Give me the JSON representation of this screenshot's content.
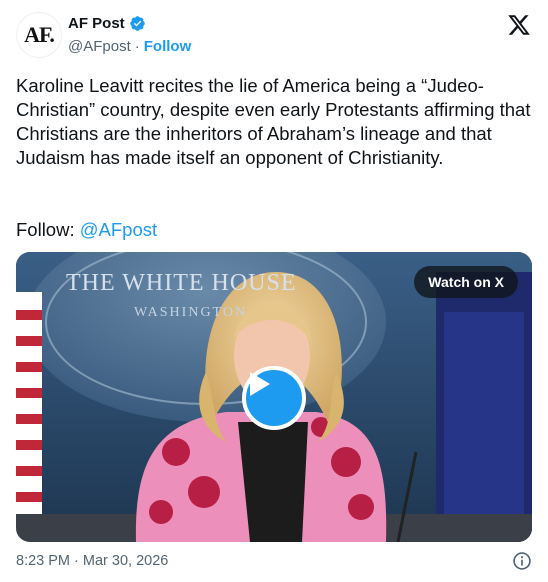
{
  "author": {
    "avatar_text": "AF.",
    "display_name": "AF Post",
    "handle": "@AFpost",
    "separator": "·",
    "follow_label": "Follow"
  },
  "tweet": {
    "text": "Karoline Leavitt recites the lie of America being a “Judeo-Christian” country, despite even early Protestants affirming that Christians are the inheritors of Abraham’s lineage and that Judaism has made itself an opponent of Christianity.",
    "follow_prefix": "Follow: ",
    "mention": "@AFpost"
  },
  "media": {
    "backdrop_text_line1": "THE WHITE HOUSE",
    "backdrop_text_line2": "WASHINGTON",
    "watch_label": "Watch on X",
    "play_icon": "play-icon"
  },
  "footer": {
    "timestamp": "8:23 PM · Mar 30, 2026",
    "info_icon": "info-icon"
  },
  "colors": {
    "accent": "#1d9bf0",
    "text": "#0f1419",
    "muted": "#536471"
  }
}
